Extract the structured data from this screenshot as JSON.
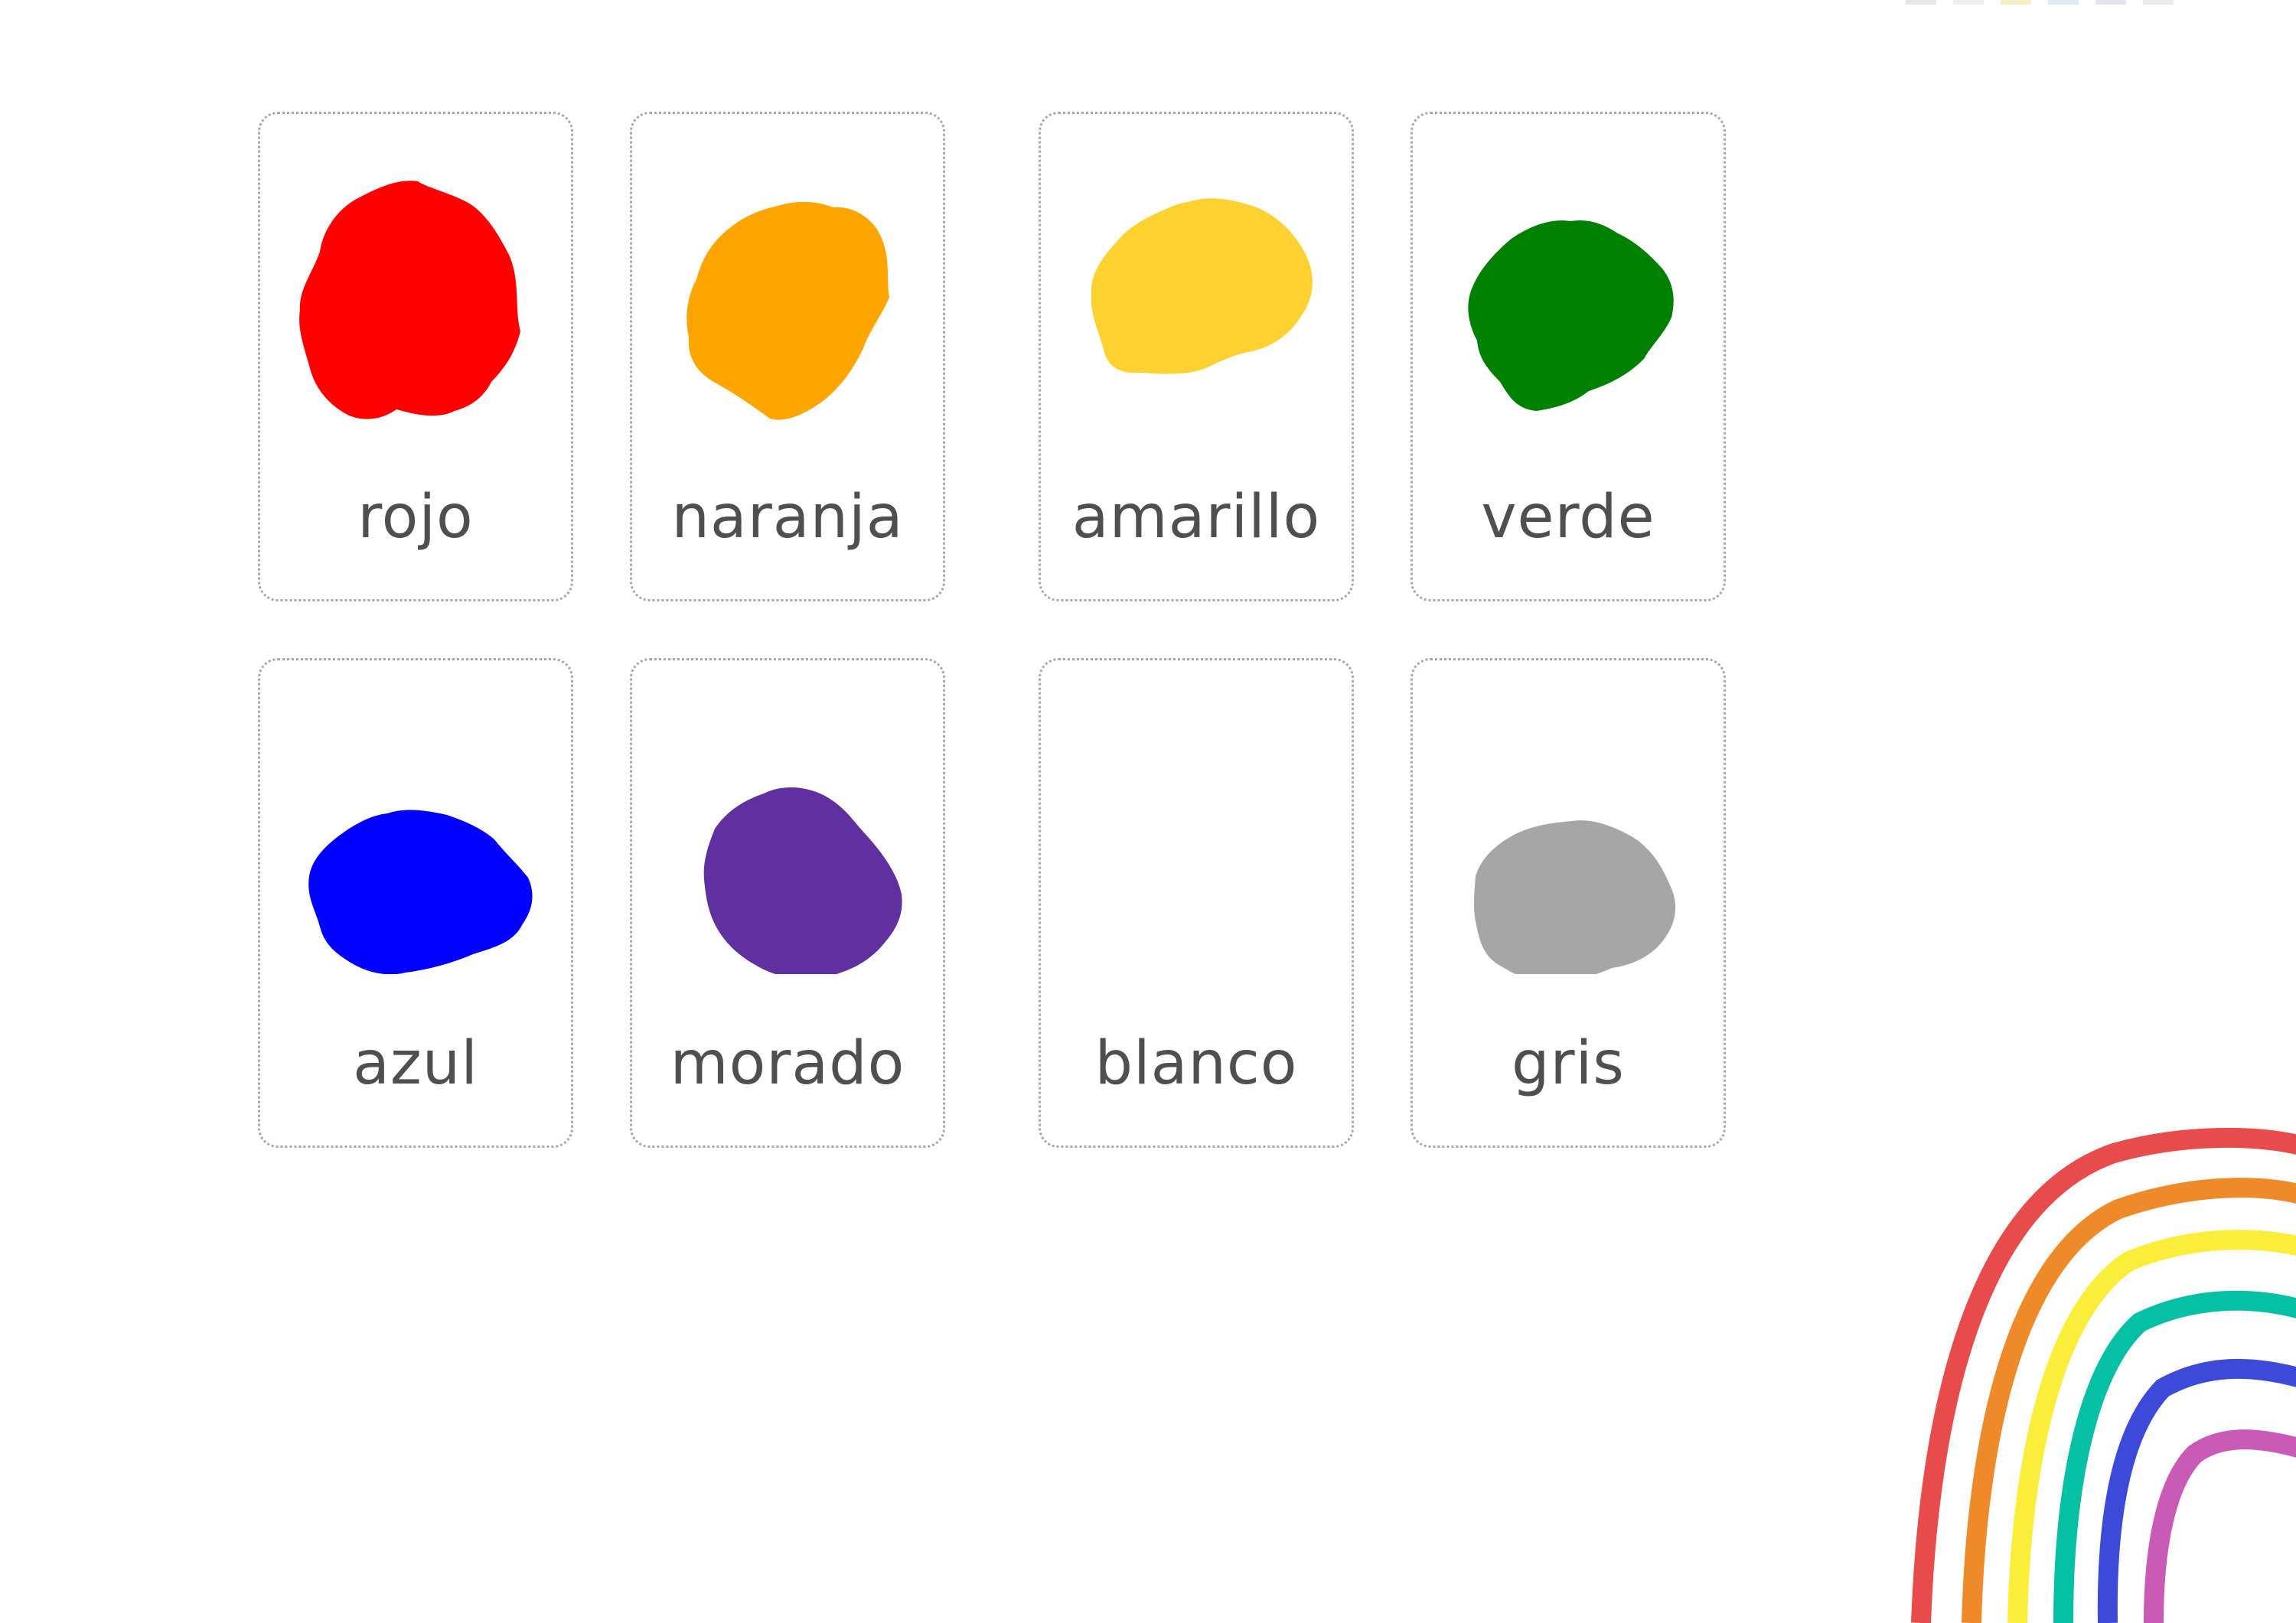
{
  "cards": [
    {
      "label": "rojo",
      "color": "#ff0000"
    },
    {
      "label": "naranja",
      "color": "#ffa500"
    },
    {
      "label": "amarillo",
      "color": "#fdd130"
    },
    {
      "label": "verde",
      "color": "#008000"
    },
    {
      "label": "azul",
      "color": "#0000ff"
    },
    {
      "label": "morado",
      "color": "#6030a0"
    },
    {
      "label": "blanco",
      "color": "#ffffff"
    },
    {
      "label": "gris",
      "color": "#a6a6a6"
    }
  ],
  "rainbow": {
    "colors": [
      "#e84b4b",
      "#ee8a2a",
      "#fbee3a",
      "#05c0a5",
      "#3d4ad9",
      "#c95ab5"
    ]
  }
}
